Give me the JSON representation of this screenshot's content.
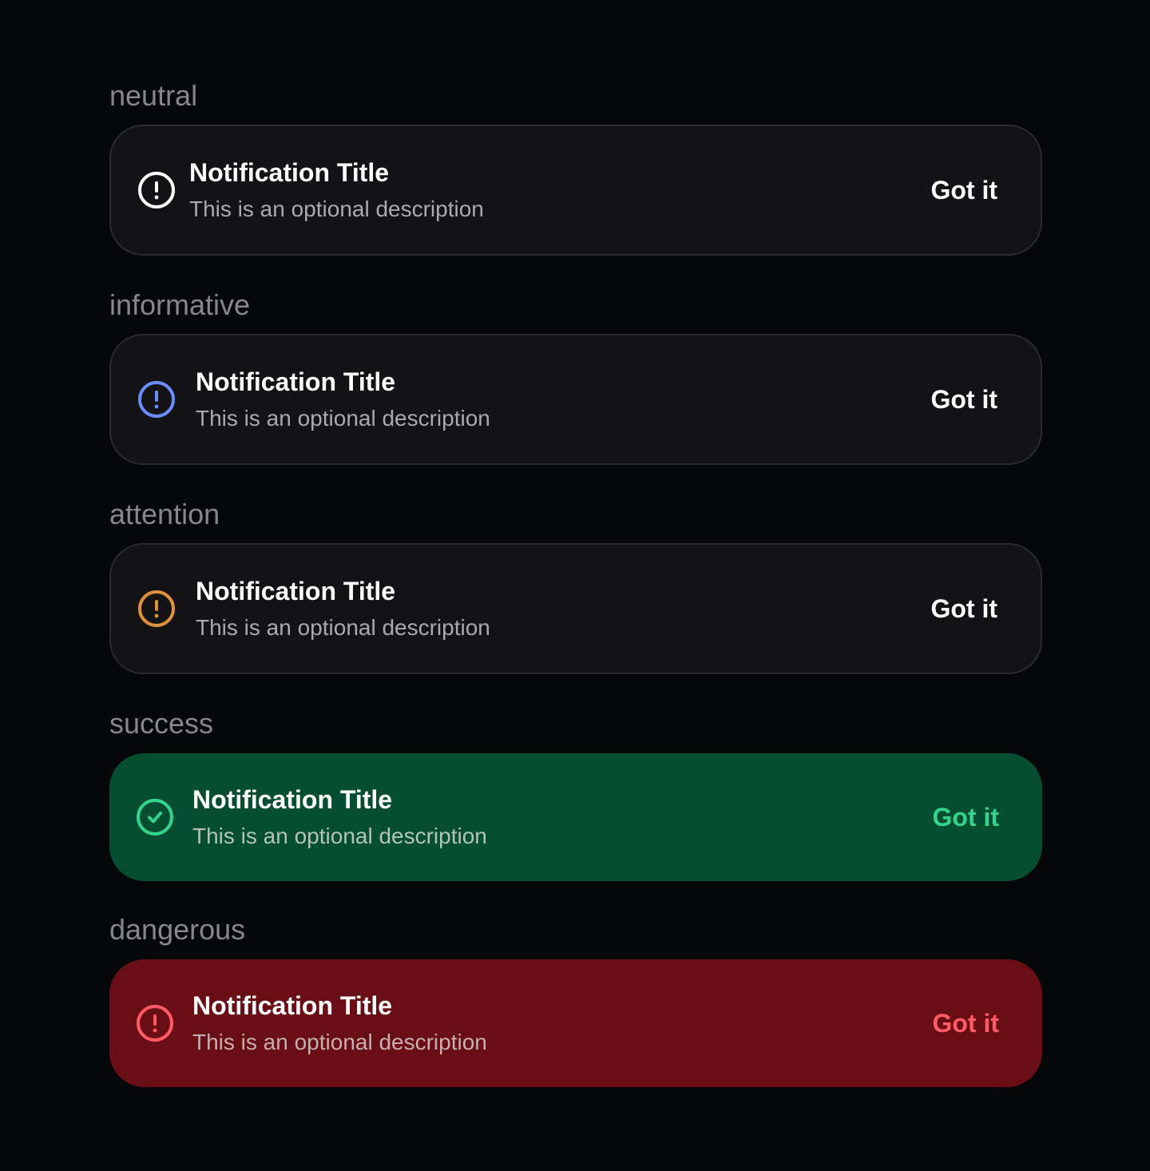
{
  "notifications": [
    {
      "variant": "neutral",
      "label": "neutral",
      "title": "Notification Title",
      "description": "This is an optional description",
      "action": "Got it",
      "icon": "exclamation-circle-icon",
      "icon_color": "#ffffff",
      "action_color": "#ffffff",
      "background": "#131316"
    },
    {
      "variant": "informative",
      "label": "informative",
      "title": "Notification Title",
      "description": "This is an optional description",
      "action": "Got it",
      "icon": "exclamation-circle-icon",
      "icon_color": "#6b8cff",
      "action_color": "#ffffff",
      "background": "#131316"
    },
    {
      "variant": "attention",
      "label": "attention",
      "title": "Notification Title",
      "description": "This is an optional description",
      "action": "Got it",
      "icon": "exclamation-circle-icon",
      "icon_color": "#e0913c",
      "action_color": "#ffffff",
      "background": "#131316"
    },
    {
      "variant": "success",
      "label": "success",
      "title": "Notification Title",
      "description": "This is an optional description",
      "action": "Got it",
      "icon": "check-circle-icon",
      "icon_color": "#34d48d",
      "action_color": "#34d48d",
      "background": "#064e32"
    },
    {
      "variant": "dangerous",
      "label": "dangerous",
      "title": "Notification Title",
      "description": "This is an optional description",
      "action": "Got it",
      "icon": "exclamation-circle-icon",
      "icon_color": "#ff5a66",
      "action_color": "#ff5a66",
      "background": "#690e15"
    }
  ]
}
